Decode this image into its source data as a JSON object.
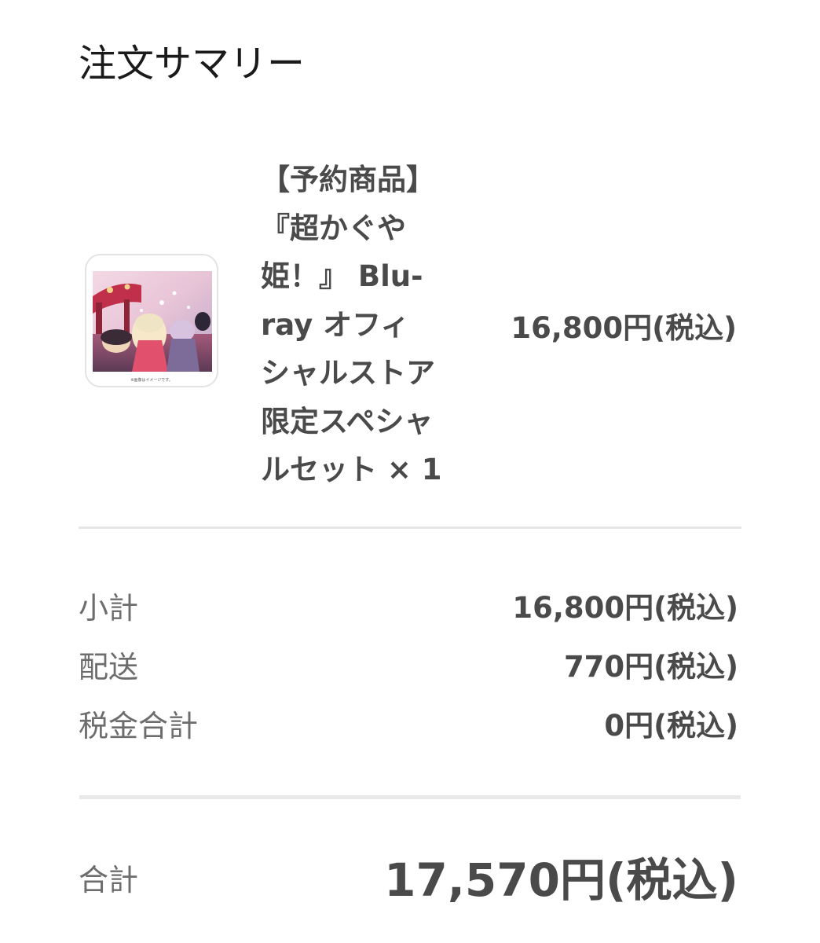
{
  "summary": {
    "title": "注文サマリー"
  },
  "item": {
    "name_lines": [
      "【予約商品】",
      "『超かぐや",
      "姫！』 Blu-",
      "ray オフィ",
      "シャルストア",
      "限定スペシャ",
      "ルセット × 1"
    ],
    "price": "16,800円(税込)",
    "thumbnail_caption": "※画像はイメージです。"
  },
  "totals": {
    "subtotal_label": "小計",
    "subtotal_value": "16,800円(税込)",
    "shipping_label": "配送",
    "shipping_value": "770円(税込)",
    "tax_label": "税金合計",
    "tax_value": "0円(税込)",
    "total_label": "合計",
    "total_value": "17,570円(税込)"
  }
}
